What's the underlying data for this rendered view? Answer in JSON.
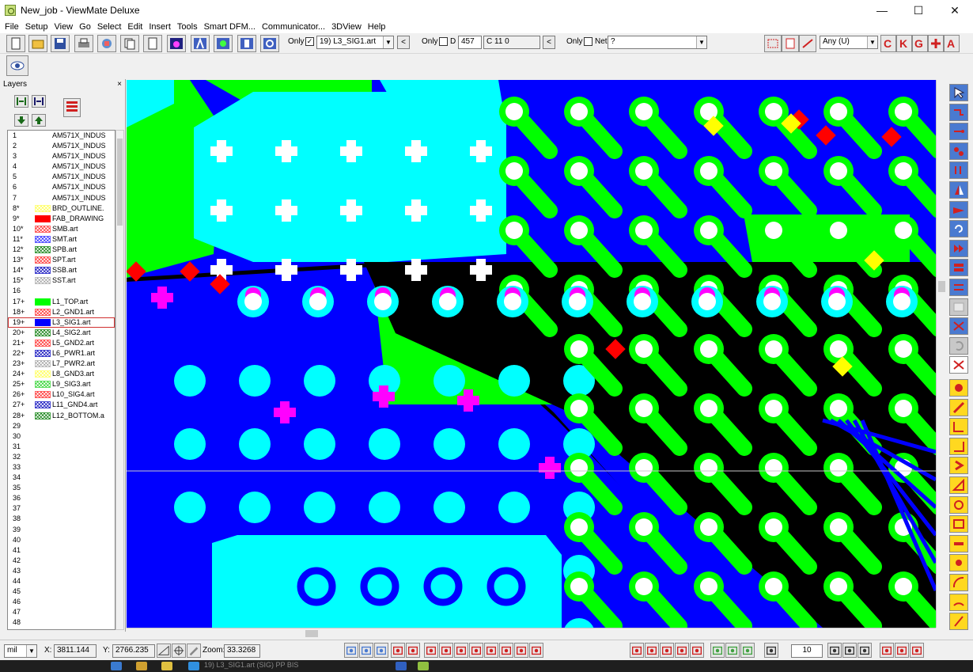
{
  "window": {
    "title": "New_job - ViewMate Deluxe",
    "minimize": "—",
    "maximize": "☐",
    "close": "✕"
  },
  "menu": [
    "File",
    "Setup",
    "View",
    "Go",
    "Select",
    "Edit",
    "Insert",
    "Tools",
    "Smart DFM...",
    "Communicator...",
    "3DView",
    "Help"
  ],
  "toolbar": {
    "only1_label": "Only",
    "only1_checked": "✓",
    "layer_select": "19) L3_SIG1.art",
    "only2_label": "Only",
    "d_label": "D",
    "d_value": "457",
    "c_value": "C 11  0",
    "only3_label": "Only",
    "net_label": "Net",
    "net_value": "?",
    "any_select": "Any   (U)",
    "prev": "<"
  },
  "layers_panel": {
    "title": "Layers",
    "close": "×",
    "rows": [
      {
        "num": "1",
        "name": "AM571X_INDUS",
        "swatch": "none"
      },
      {
        "num": "2",
        "name": "AM571X_INDUS",
        "swatch": "none"
      },
      {
        "num": "3",
        "name": "AM571X_INDUS",
        "swatch": "none"
      },
      {
        "num": "4",
        "name": "AM571X_INDUS",
        "swatch": "none"
      },
      {
        "num": "5",
        "name": "AM571X_INDUS",
        "swatch": "none"
      },
      {
        "num": "6",
        "name": "AM571X_INDUS",
        "swatch": "none"
      },
      {
        "num": "7",
        "name": "AM571X_INDUS",
        "swatch": "none"
      },
      {
        "num": "8*",
        "name": "BRD_OUTLINE.",
        "swatch": "#ffff80"
      },
      {
        "num": "9*",
        "name": "FAB_DRAWING",
        "swatch": "#ff0000"
      },
      {
        "num": "10*",
        "name": "SMB.art",
        "swatch": "#ff6060"
      },
      {
        "num": "11*",
        "name": "SMT.art",
        "swatch": "#6060ff"
      },
      {
        "num": "12*",
        "name": "SPB.art",
        "swatch": "#40a040"
      },
      {
        "num": "13*",
        "name": "SPT.art",
        "swatch": "#ff6060"
      },
      {
        "num": "14*",
        "name": "SSB.art",
        "swatch": "#4040d0"
      },
      {
        "num": "15*",
        "name": "SST.art",
        "swatch": "#c0c0c0"
      },
      {
        "num": "16",
        "name": "",
        "swatch": "none"
      },
      {
        "num": "17+",
        "name": "L1_TOP.art",
        "swatch": "#00ff00"
      },
      {
        "num": "18+",
        "name": "L2_GND1.art",
        "swatch": "#ff6060"
      },
      {
        "num": "19+",
        "name": "L3_SIG1.art",
        "swatch": "#0000ff"
      },
      {
        "num": "20+",
        "name": "L4_SIG2.art",
        "swatch": "#40a040"
      },
      {
        "num": "21+",
        "name": "L5_GND2.art",
        "swatch": "#ff6060"
      },
      {
        "num": "22+",
        "name": "L6_PWR1.art",
        "swatch": "#4040d0"
      },
      {
        "num": "23+",
        "name": "L7_PWR2.art",
        "swatch": "#c0c0c0"
      },
      {
        "num": "24+",
        "name": "L8_GND3.art",
        "swatch": "#ffff80"
      },
      {
        "num": "25+",
        "name": "L9_SIG3.art",
        "swatch": "#60e060"
      },
      {
        "num": "26+",
        "name": "L10_SIG4.art",
        "swatch": "#ff6060"
      },
      {
        "num": "27+",
        "name": "L11_GND4.art",
        "swatch": "#4040d0"
      },
      {
        "num": "28+",
        "name": "L12_BOTTOM.a",
        "swatch": "#40a040"
      },
      {
        "num": "29",
        "name": "",
        "swatch": "none"
      },
      {
        "num": "30",
        "name": "",
        "swatch": "none"
      },
      {
        "num": "31",
        "name": "",
        "swatch": "none"
      },
      {
        "num": "32",
        "name": "",
        "swatch": "none"
      },
      {
        "num": "33",
        "name": "",
        "swatch": "none"
      },
      {
        "num": "34",
        "name": "",
        "swatch": "none"
      },
      {
        "num": "35",
        "name": "",
        "swatch": "none"
      },
      {
        "num": "36",
        "name": "",
        "swatch": "none"
      },
      {
        "num": "37",
        "name": "",
        "swatch": "none"
      },
      {
        "num": "38",
        "name": "",
        "swatch": "none"
      },
      {
        "num": "39",
        "name": "",
        "swatch": "none"
      },
      {
        "num": "40",
        "name": "",
        "swatch": "none"
      },
      {
        "num": "41",
        "name": "",
        "swatch": "none"
      },
      {
        "num": "42",
        "name": "",
        "swatch": "none"
      },
      {
        "num": "43",
        "name": "",
        "swatch": "none"
      },
      {
        "num": "44",
        "name": "",
        "swatch": "none"
      },
      {
        "num": "45",
        "name": "",
        "swatch": "none"
      },
      {
        "num": "46",
        "name": "",
        "swatch": "none"
      },
      {
        "num": "47",
        "name": "",
        "swatch": "none"
      },
      {
        "num": "48",
        "name": "",
        "swatch": "none"
      }
    ],
    "selected_index": 18
  },
  "status": {
    "units": "mil",
    "x_label": "X:",
    "x_value": "3811.144",
    "y_label": "Y:",
    "y_value": "2766.235",
    "zoom_label": "Zoom:",
    "zoom_value": "33.3268",
    "grid_value": "10"
  },
  "taskbar": {
    "text": "19) L3_SIG1.art (SIG) PP BIS"
  },
  "colors": {
    "copper_top": "#00ff00",
    "sig1": "#0000ff",
    "plane": "#00ffff",
    "flash": "#ff00ff",
    "pad_red": "#ff0000",
    "pad_yellow": "#ffff00",
    "hole": "#ffffff"
  }
}
